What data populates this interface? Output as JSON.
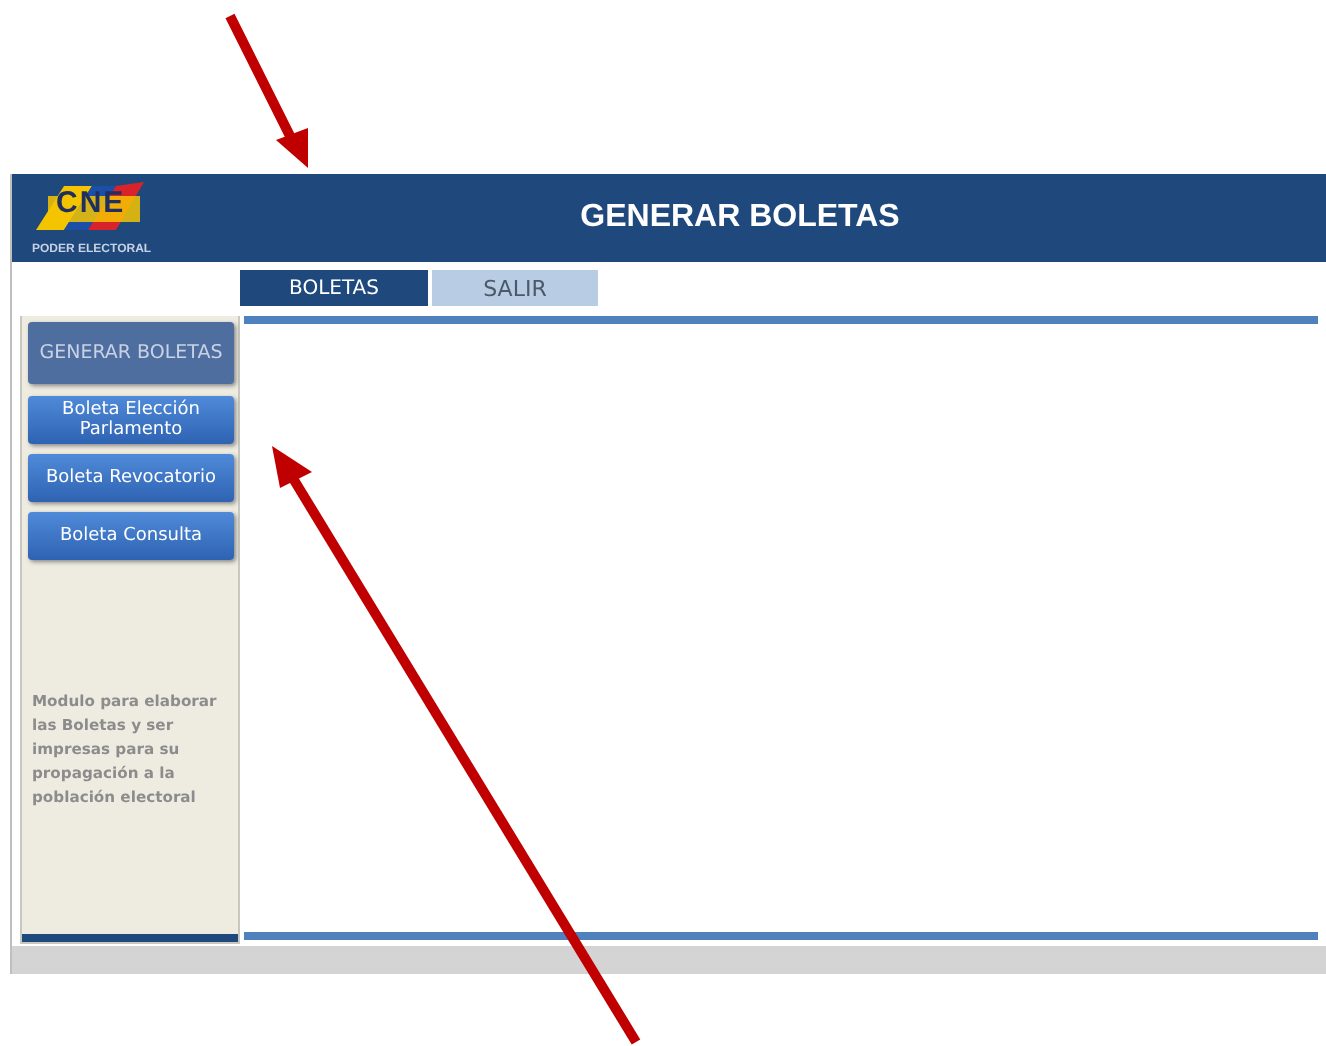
{
  "header": {
    "logo_text": "CNE",
    "logo_subtitle": "PODER ELECTORAL",
    "title": "GENERAR BOLETAS"
  },
  "tabs": [
    {
      "label": "BOLETAS",
      "selected": true
    },
    {
      "label": "SALIR",
      "selected": false
    }
  ],
  "sidebar": {
    "buttons": [
      {
        "label": "GENERAR BOLETAS",
        "kind": "header"
      },
      {
        "label": "Boleta Elección Parlamento",
        "kind": "action"
      },
      {
        "label": "Boleta Revocatorio",
        "kind": "action"
      },
      {
        "label": "Boleta Consulta",
        "kind": "action"
      }
    ],
    "description": "Modulo para elaborar las Boletas y ser impresas para su propagación a la población electoral"
  }
}
